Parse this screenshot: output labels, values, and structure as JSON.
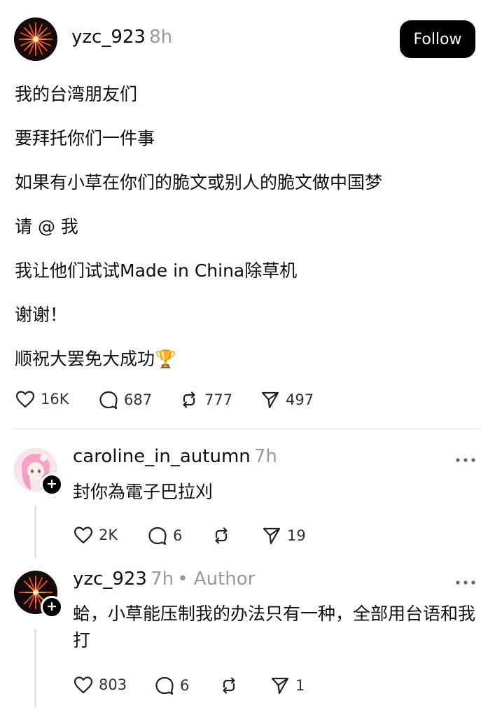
{
  "post": {
    "username": "yzc_923",
    "time": "8h",
    "follow_label": "Follow",
    "lines": [
      "我的台湾朋友们",
      "要拜托你们一件事",
      "如果有小草在你们的脆文或别人的脆文做中国梦",
      "请 @ 我",
      "我让他们试试Made in China除草机",
      "谢谢！",
      "顺祝大罢免大成功🏆"
    ],
    "likes": "16K",
    "comments": "687",
    "reposts": "777",
    "shares": "497"
  },
  "replies": [
    {
      "username": "caroline_in_autumn",
      "time": "7h",
      "author_tag": "",
      "text": "封你為電子巴拉刈",
      "likes": "2K",
      "comments": "6",
      "reposts": "",
      "shares": "19"
    },
    {
      "username": "yzc_923",
      "time": "7h",
      "author_tag": "• Author",
      "text": "蛤，小草能压制我的办法只有一种，全部用台语和我打",
      "likes": "803",
      "comments": "6",
      "reposts": "",
      "shares": "1"
    }
  ],
  "icons": {
    "like": "heart-icon",
    "comment": "comment-bubble-icon",
    "repost": "repost-icon",
    "share": "paper-plane-icon",
    "more": "more-dots-icon",
    "follow_plus": "plus-icon"
  },
  "colors": {
    "follow_button": "#000000",
    "muted_text": "#999999"
  }
}
